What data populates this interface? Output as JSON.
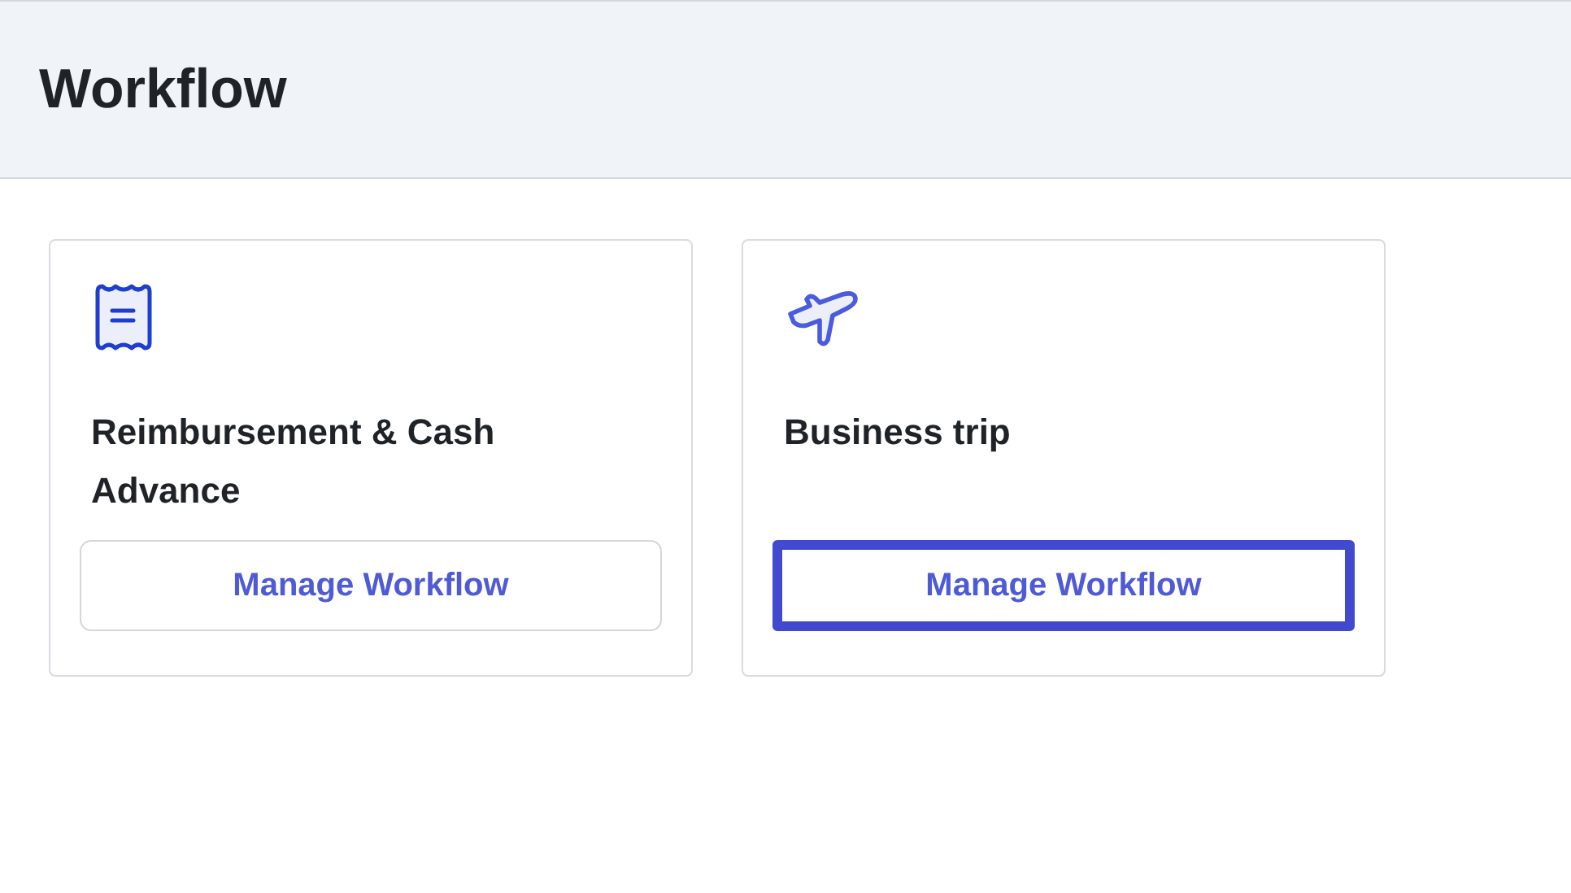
{
  "page": {
    "title": "Workflow"
  },
  "cards": [
    {
      "kind": "receipt",
      "title": "Reimbursement & Cash Advance",
      "button": {
        "label": "Manage Workflow",
        "focused": false
      }
    },
    {
      "kind": "plane",
      "title": "Business trip",
      "button": {
        "label": "Manage Workflow",
        "focused": true
      }
    }
  ]
}
